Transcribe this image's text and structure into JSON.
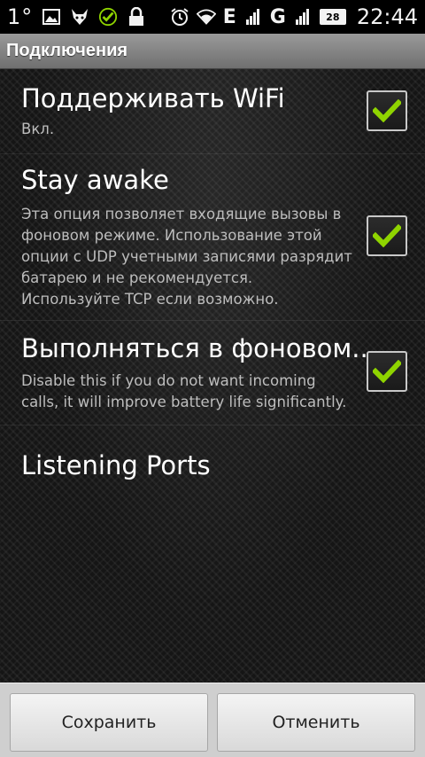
{
  "status_bar": {
    "temperature": "1°",
    "network_type": "E",
    "network_type_2": "G",
    "battery_level": "28",
    "time": "22:44",
    "icons": [
      "image-icon",
      "cat-icon",
      "check-circle-icon",
      "lock-icon",
      "alarm-icon",
      "wifi-icon",
      "signal-icon",
      "signal-icon",
      "battery-icon"
    ]
  },
  "titlebar": {
    "title": "Подключения"
  },
  "preferences": [
    {
      "title": "Поддерживать WiFi",
      "summary": "Вкл.",
      "checked": true
    },
    {
      "title": "Stay awake",
      "summary": "Эта опция позволяет входящие вызовы в фоновом режиме. Использование этой опции с UDP учетными записями разрядит батарею и не рекомендуется. Используйте TCP если возможно.",
      "checked": true
    },
    {
      "title": "Выполняться в фоновом..",
      "summary": "Disable this if you do not want incoming calls, it will improve battery life significantly.",
      "checked": true
    },
    {
      "title": "Listening Ports"
    }
  ],
  "buttons": {
    "save": "Сохранить",
    "cancel": "Отменить"
  },
  "colors": {
    "checkmark": "#8fd400",
    "titlebar": "#8a8a8a",
    "buttons_bar": "#cfcfcf"
  }
}
